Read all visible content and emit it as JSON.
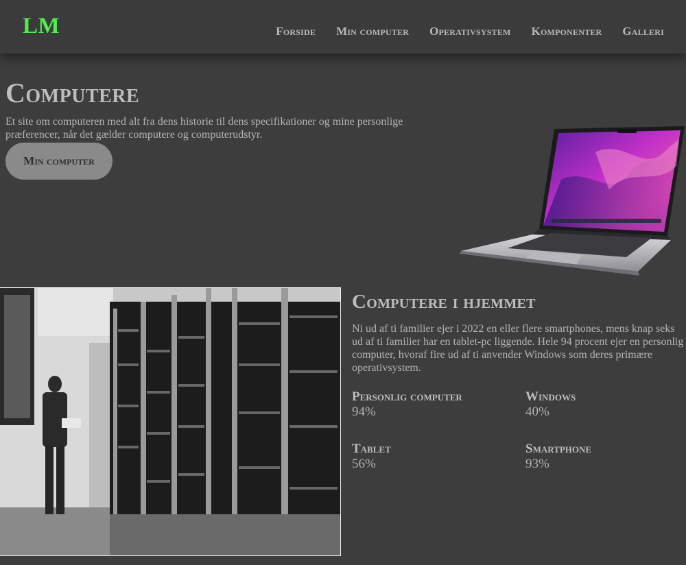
{
  "header": {
    "logo": "LM",
    "logo_color": "#4cf04c",
    "nav": [
      {
        "label": "Forside"
      },
      {
        "label": "Min computer"
      },
      {
        "label": "Operativsystem"
      },
      {
        "label": "Komponenter"
      },
      {
        "label": "Galleri"
      }
    ]
  },
  "hero": {
    "title": "Computere",
    "text": "Et site om computeren med alt fra dens historie til dens specifikationer og mine personlige præferencer, når det gælder computere og computerudstyr.",
    "button_label": "Min computer",
    "image": "laptop-image"
  },
  "home_section": {
    "title": "Computere i hjemmet",
    "text": "Ni ud af ti familier ejer i 2022 en eller flere smartphones, mens knap seks ud af ti familier har en tablet-pc liggende. Hele 94 procent ejer en personlig computer, hvoraf fire ud af ti anvender Windows som deres primære operativsystem.",
    "image": "vintage-mainframe-photo",
    "stats": [
      {
        "label": "Personlig computer",
        "value": "94%"
      },
      {
        "label": "Windows",
        "value": "40%"
      },
      {
        "label": "Tablet",
        "value": "56%"
      },
      {
        "label": "Smartphone",
        "value": "93%"
      }
    ]
  },
  "colors": {
    "background": "#3d3d3d",
    "header": "#3b3b3b",
    "text": "#b3b3b3",
    "button": "#8a8a8a"
  }
}
